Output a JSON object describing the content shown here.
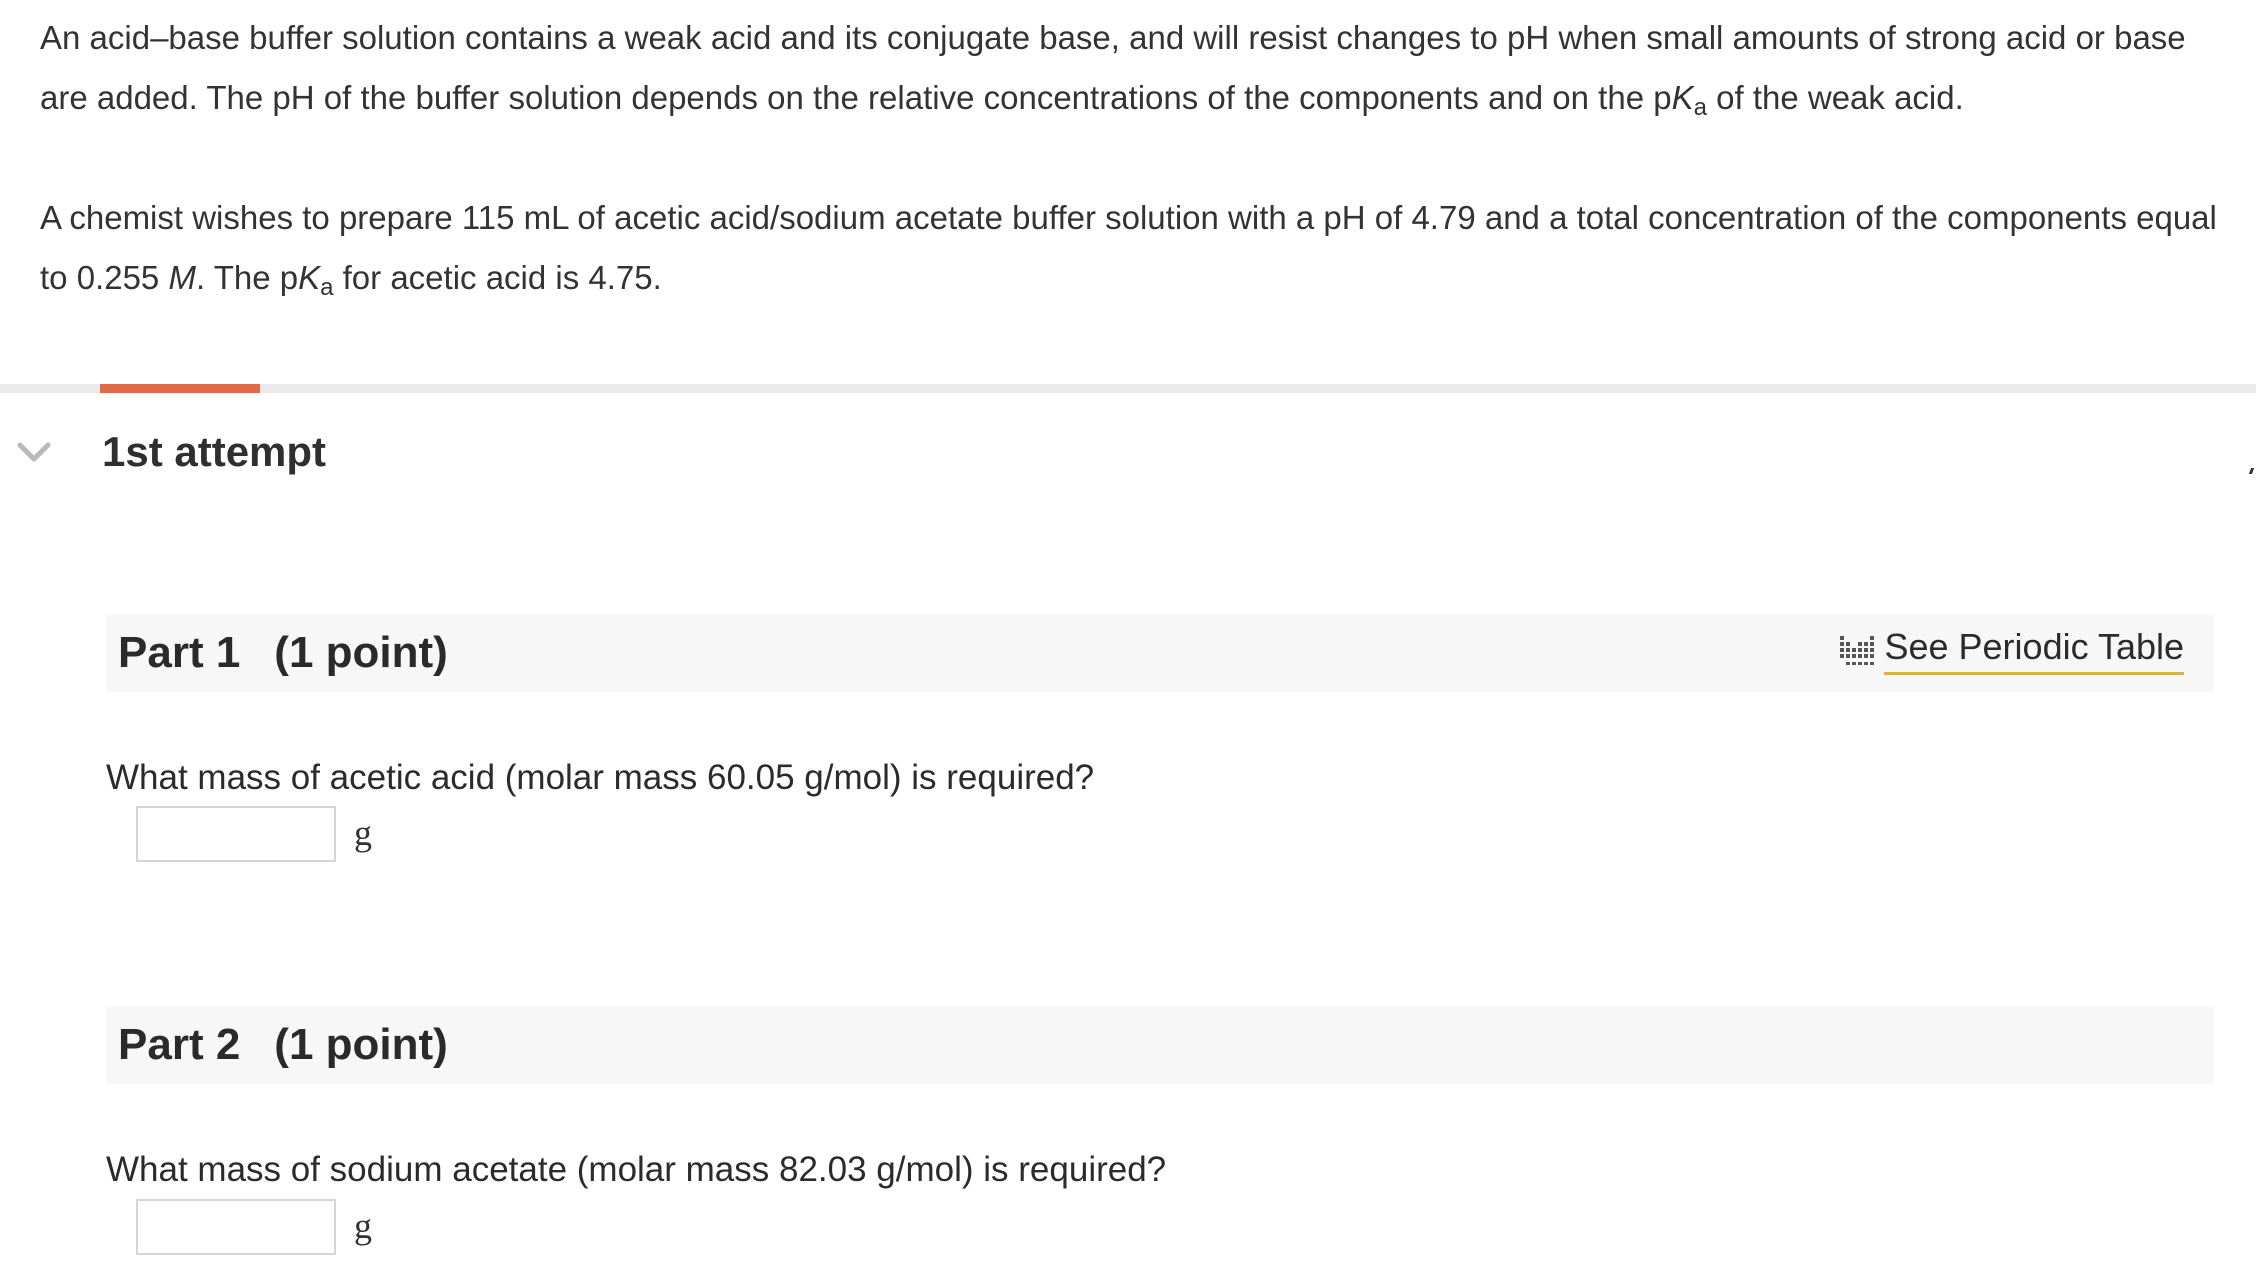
{
  "intro": {
    "p1_before": "An acid–base buffer solution contains a weak acid and its conjugate base, and will resist changes to pH when small amounts of strong acid or base are added. The pH of the buffer solution depends on the relative concentrations of the components and on the p",
    "p1_K": "K",
    "p1_sub": "a",
    "p1_after": " of the weak acid.",
    "p2_before": "A chemist wishes to prepare 115 mL of acetic acid/sodium acetate buffer solution with a pH of 4.79  and a total concentration of the components equal to 0.255 ",
    "p2_M": "M",
    "p2_mid": ". The p",
    "p2_K": "K",
    "p2_sub": "a",
    "p2_after": " for acetic acid is 4.75."
  },
  "attempt": {
    "title": "1st attempt",
    "progress_fraction": 0.0709
  },
  "colors": {
    "progress_accent": "#e0694a",
    "link_underline": "#d9b24a"
  },
  "periodic_table": {
    "label": "See Periodic Table",
    "icon": "periodic-table-icon"
  },
  "parts": [
    {
      "title": "Part 1",
      "points": "(1 point)",
      "question": "What mass of acetic acid (molar mass 60.05 g/mol) is required?",
      "answer_value": "",
      "unit": "g"
    },
    {
      "title": "Part 2",
      "points": "(1 point)",
      "question": "What mass of sodium acetate (molar mass 82.03 g/mol) is required?",
      "answer_value": "",
      "unit": "g"
    }
  ]
}
